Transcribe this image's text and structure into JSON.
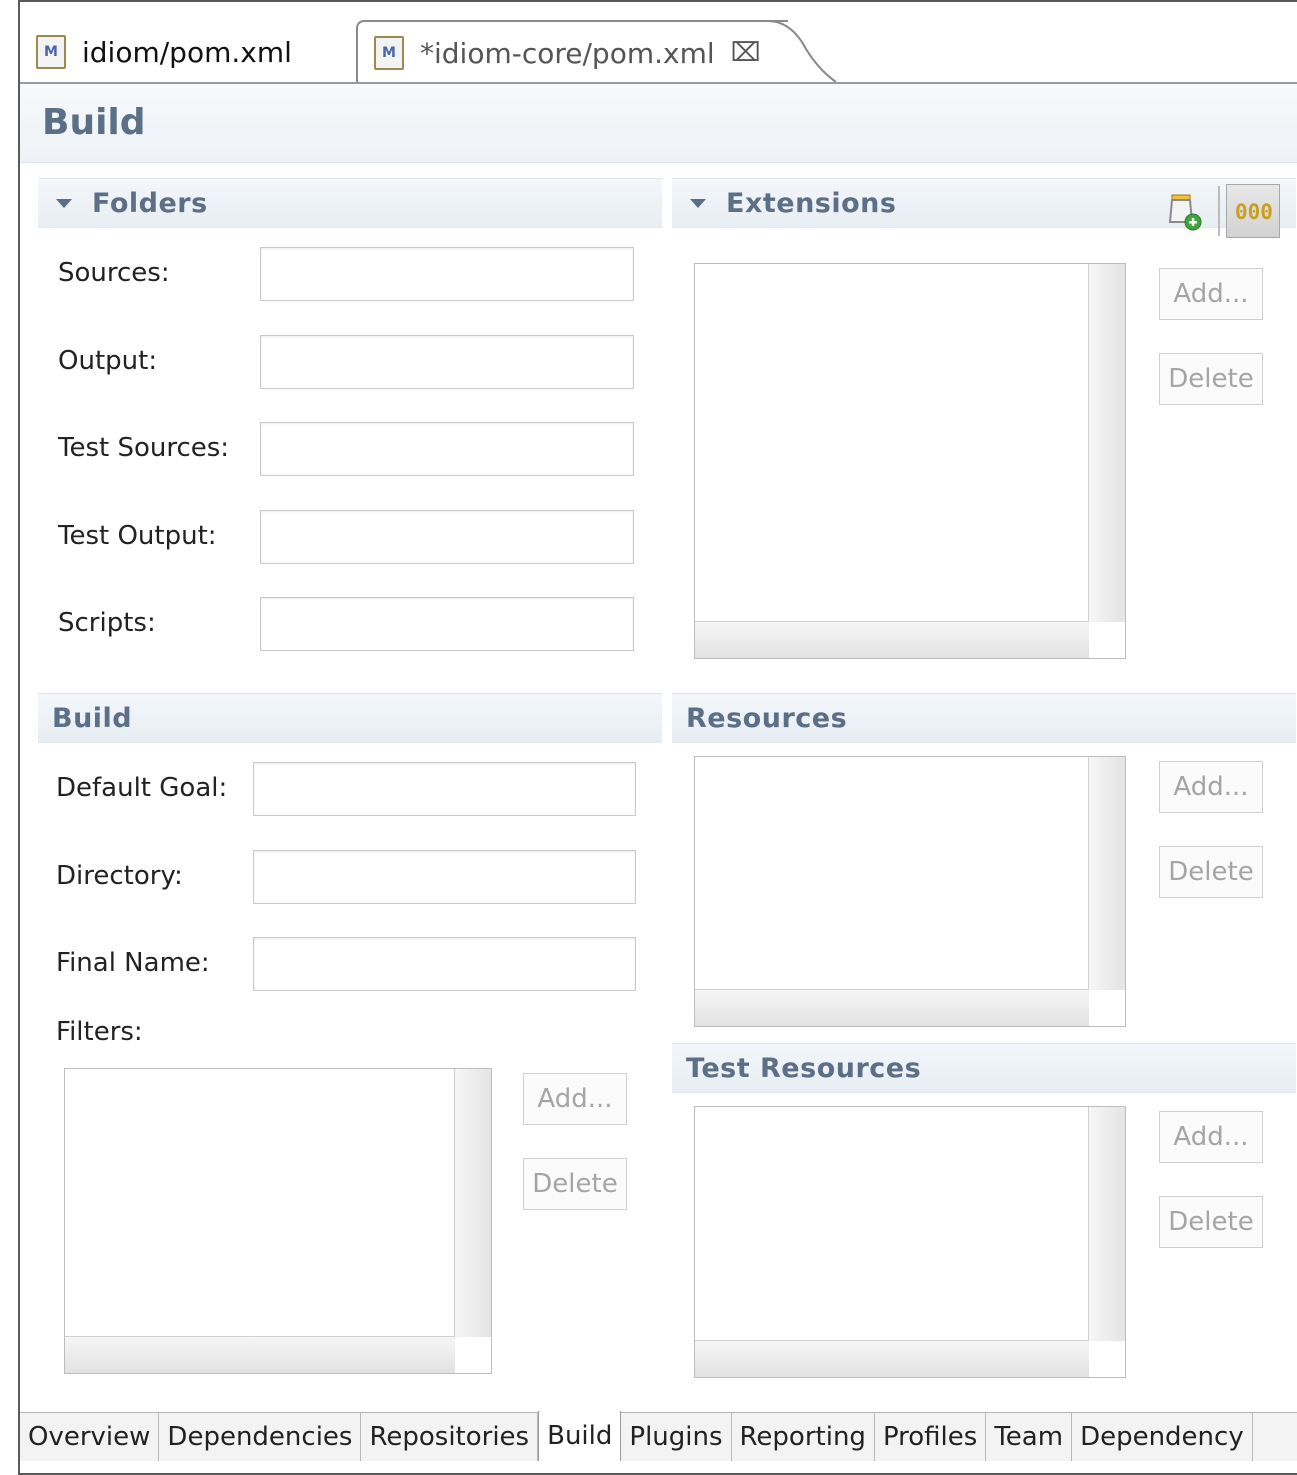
{
  "editor_tabs": [
    {
      "label": "idiom/pom.xml",
      "icon": "maven-file-icon"
    },
    {
      "label": "*idiom-core/pom.xml",
      "icon": "maven-file-icon",
      "close": "close-icon"
    }
  ],
  "page_title": "Build",
  "folders": {
    "title": "Folders",
    "fields": [
      {
        "label": "Sources:",
        "value": ""
      },
      {
        "label": "Output:",
        "value": ""
      },
      {
        "label": "Test Sources:",
        "value": ""
      },
      {
        "label": "Test Output:",
        "value": ""
      },
      {
        "label": "Scripts:",
        "value": ""
      }
    ]
  },
  "extensions": {
    "title": "Extensions",
    "add": "Add...",
    "delete": "Delete",
    "tools": [
      "add-extension-icon",
      "show-groupid-icon"
    ]
  },
  "build": {
    "title": "Build",
    "fields": [
      {
        "label": "Default Goal:",
        "value": ""
      },
      {
        "label": "Directory:",
        "value": ""
      },
      {
        "label": "Final Name:",
        "value": ""
      }
    ],
    "filters_label": "Filters:",
    "add": "Add...",
    "delete": "Delete"
  },
  "resources": {
    "title": "Resources",
    "add": "Add...",
    "delete": "Delete"
  },
  "test_resources": {
    "title": "Test Resources",
    "add": "Add...",
    "delete": "Delete"
  },
  "page_tabs": [
    "Overview",
    "Dependencies",
    "Repositories",
    "Build",
    "Plugins",
    "Reporting",
    "Profiles",
    "Team",
    "Dependency"
  ],
  "active_page_tab": "Build"
}
